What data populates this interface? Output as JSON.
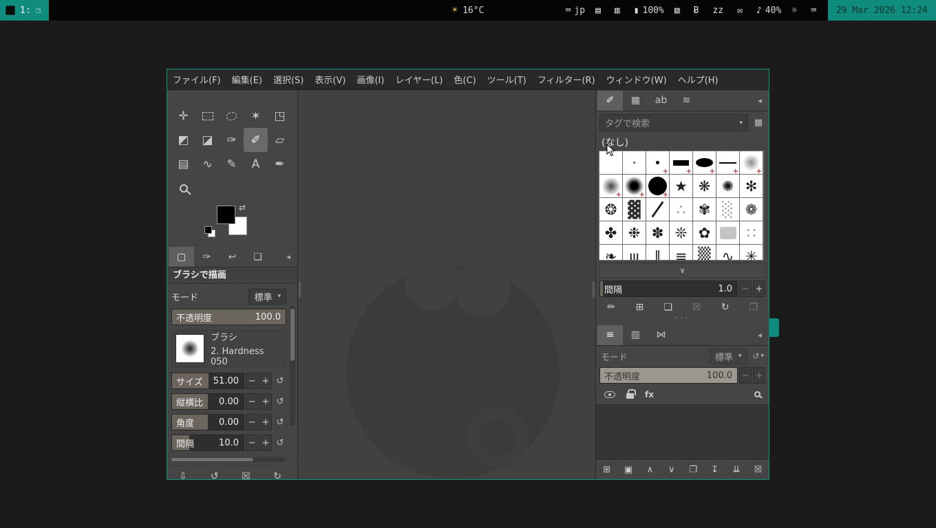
{
  "statusbar": {
    "workspace": {
      "label": "1:",
      "window_icon": "❐"
    },
    "weather": {
      "icon": "☀",
      "temp": "16°C"
    },
    "modules": [
      {
        "name": "keyboard-layout-indicator",
        "icon": "⌨",
        "label": "jp"
      },
      {
        "name": "clipboard-indicator",
        "icon": "▤",
        "label": ""
      },
      {
        "name": "notes-indicator",
        "icon": "▥",
        "label": ""
      },
      {
        "name": "battery-indicator",
        "icon": "▮",
        "label": "100%"
      },
      {
        "name": "display-indicator",
        "icon": "▧",
        "label": ""
      },
      {
        "name": "bluetooth-indicator",
        "icon": "Ƀ",
        "label": ""
      },
      {
        "name": "idle-inhibitor",
        "icon": "zz",
        "label": ""
      },
      {
        "name": "notifications-indicator",
        "icon": "✉",
        "label": ""
      },
      {
        "name": "volume-indicator",
        "icon": "♪",
        "label": "40%"
      },
      {
        "name": "brightness-indicator",
        "icon": "☼",
        "label": ""
      },
      {
        "name": "input-method-indicator",
        "icon": "⌨",
        "label": ""
      }
    ],
    "clock": "29 Mar 2026 12:24"
  },
  "gimp": {
    "menubar": [
      "ファイル(F)",
      "編集(E)",
      "選択(S)",
      "表示(V)",
      "画像(I)",
      "レイヤー(L)",
      "色(C)",
      "ツール(T)",
      "フィルター(R)",
      "ウィンドウ(W)",
      "ヘルプ(H)"
    ],
    "toolbox": {
      "swap_icon": "⇄",
      "tools": [
        {
          "name": "move-tool",
          "g": "✛",
          "cls": ""
        },
        {
          "name": "rectangle-select-tool",
          "g": "",
          "cls": "t-rect"
        },
        {
          "name": "free-select-tool",
          "g": "",
          "cls": "t-free"
        },
        {
          "name": "fuzzy-select-tool",
          "g": "✶",
          "cls": ""
        },
        {
          "name": "crop-tool",
          "g": "◳",
          "cls": ""
        },
        {
          "name": "transform-tool",
          "g": "◩",
          "cls": ""
        },
        {
          "name": "bucket-fill-tool",
          "g": "◪",
          "cls": ""
        },
        {
          "name": "ink-tool",
          "g": "✑",
          "cls": ""
        },
        {
          "name": "paintbrush-tool",
          "g": "✐",
          "cls": "active"
        },
        {
          "name": "eraser-tool",
          "g": "▱",
          "cls": ""
        },
        {
          "name": "clone-tool",
          "g": "▤",
          "cls": ""
        },
        {
          "name": "smudge-tool",
          "g": "∿",
          "cls": ""
        },
        {
          "name": "paths-tool",
          "g": "✎",
          "cls": ""
        },
        {
          "name": "text-tool",
          "g": "A",
          "cls": ""
        },
        {
          "name": "color-picker-tool",
          "g": "✒",
          "cls": ""
        },
        {
          "name": "zoom-tool",
          "g": "",
          "cls": "t-zoom"
        }
      ]
    },
    "left_dock": {
      "menu_icon": "◂",
      "tabs": [
        {
          "name": "tab-tool-options",
          "g": "▢",
          "cls": "active"
        },
        {
          "name": "tab-device-status",
          "g": "✑",
          "cls": ""
        },
        {
          "name": "tab-undo-history",
          "g": "↩",
          "cls": ""
        },
        {
          "name": "tab-images",
          "g": "❏",
          "cls": ""
        }
      ]
    },
    "tool_options": {
      "title": "ブラシで描画",
      "mode": {
        "label": "モード",
        "value": "標準",
        "chev": "▾"
      },
      "opacity": {
        "label": "不透明度",
        "value": "100.0",
        "fill": 100
      },
      "brush": {
        "label": "ブラシ",
        "value": "2. Hardness 050"
      },
      "sliders": [
        {
          "name": "size-slider",
          "label": "サイズ",
          "value": "51.00",
          "fill": 51,
          "minus": "−",
          "plus": "+",
          "reset": "↺"
        },
        {
          "name": "aspect-ratio-slider",
          "label": "縦横比",
          "value": "0.00",
          "fill": 50,
          "minus": "−",
          "plus": "+",
          "reset": "↺"
        },
        {
          "name": "angle-slider",
          "label": "角度",
          "value": "0.00",
          "fill": 50,
          "minus": "−",
          "plus": "+",
          "reset": "↺"
        },
        {
          "name": "spacing-slider",
          "label": "間隔",
          "value": "10.0",
          "fill": 24,
          "minus": "−",
          "plus": "+",
          "reset": "↺"
        }
      ],
      "footer": [
        {
          "name": "save-tool-preset-button",
          "g": "⇩"
        },
        {
          "name": "restore-tool-preset-button",
          "g": "↺"
        },
        {
          "name": "delete-tool-preset-button",
          "g": "☒"
        },
        {
          "name": "reset-tool-options-button",
          "g": "↻"
        }
      ]
    },
    "brushes_dock": {
      "menu_icon": "◂",
      "tabs": [
        {
          "name": "tab-brushes",
          "g": "✐",
          "cls": "active"
        },
        {
          "name": "tab-patterns",
          "g": "▦",
          "cls": ""
        },
        {
          "name": "tab-fonts",
          "g": "ab",
          "cls": ""
        },
        {
          "name": "tab-document-history",
          "g": "≋",
          "cls": ""
        }
      ],
      "search": {
        "placeholder": "タグで検索",
        "chev": "▾"
      },
      "view_button_icon": "▦",
      "selected_tag": "(なし)",
      "expand_icon": "∨",
      "sizer": "···",
      "spacing": {
        "name": "brush-spacing-slider",
        "label": "間隔",
        "value": "1.0",
        "fill": 2,
        "minus": "−",
        "plus": "+"
      },
      "grid": [
        {
          "cls": "bc-blank",
          "g": ""
        },
        {
          "cls": "bc-speck",
          "g": ""
        },
        {
          "cls": "bc-dot plus",
          "g": ""
        },
        {
          "cls": "bc-bar plus",
          "g": ""
        },
        {
          "cls": "bc-ell plus",
          "g": ""
        },
        {
          "cls": "bc-line plus",
          "g": ""
        },
        {
          "cls": "bc-soft1 plus",
          "g": ""
        },
        {
          "cls": "bc-soft2 plus",
          "g": ""
        },
        {
          "cls": "bc-soft3 plus",
          "g": ""
        },
        {
          "cls": "bc-disc plus",
          "g": ""
        },
        {
          "cls": "",
          "g": "★"
        },
        {
          "cls": "",
          "g": "❋"
        },
        {
          "cls": "",
          "g": "✺"
        },
        {
          "cls": "",
          "g": "✻"
        },
        {
          "cls": "",
          "g": "❂"
        },
        {
          "cls": "bc-dark",
          "g": "▓"
        },
        {
          "cls": "bc-stroke",
          "g": ""
        },
        {
          "cls": "bc-lite",
          "g": "∴"
        },
        {
          "cls": "",
          "g": "✾"
        },
        {
          "cls": "bc-lite",
          "g": "░"
        },
        {
          "cls": "",
          "g": "❁"
        },
        {
          "cls": "",
          "g": "✤"
        },
        {
          "cls": "",
          "g": "❉"
        },
        {
          "cls": "",
          "g": "✽"
        },
        {
          "cls": "",
          "g": "❊"
        },
        {
          "cls": "",
          "g": "✿"
        },
        {
          "cls": "bc-softsq",
          "g": ""
        },
        {
          "cls": "bc-lite",
          "g": "∷"
        },
        {
          "cls": "",
          "g": "❧"
        },
        {
          "cls": "",
          "g": "ψ"
        },
        {
          "cls": "",
          "g": "∥"
        },
        {
          "cls": "",
          "g": "≡"
        },
        {
          "cls": "bc-dark",
          "g": "▒"
        },
        {
          "cls": "",
          "g": "∿"
        },
        {
          "cls": "",
          "g": "✳"
        }
      ],
      "actions": [
        {
          "name": "edit-brush-button",
          "g": "✏",
          "cls": ""
        },
        {
          "name": "new-brush-button",
          "g": "⊞",
          "cls": ""
        },
        {
          "name": "duplicate-brush-button",
          "g": "❏",
          "cls": ""
        },
        {
          "name": "delete-brush-button",
          "g": "☒",
          "cls": "disabled"
        },
        {
          "name": "refresh-brushes-button",
          "g": "↻",
          "cls": ""
        },
        {
          "name": "open-brush-as-image-button",
          "g": "❐",
          "cls": "disabled"
        }
      ]
    },
    "layers_dock": {
      "menu_icon": "◂",
      "tabs": [
        {
          "name": "tab-layers",
          "g": "≡",
          "cls": "active"
        },
        {
          "name": "tab-channels",
          "g": "▥",
          "cls": ""
        },
        {
          "name": "tab-paths",
          "g": "⋈",
          "cls": ""
        }
      ],
      "mode": {
        "label": "モード",
        "value": "標準",
        "chev": "▾",
        "reset": "↺"
      },
      "opacity": {
        "label": "不透明度",
        "value": "100.0",
        "fill": 100,
        "minus": "−",
        "plus": "+"
      },
      "header": {
        "fx": "fx"
      },
      "footer": [
        {
          "name": "new-layer-button",
          "g": "⊞"
        },
        {
          "name": "new-layer-group-button",
          "g": "▣"
        },
        {
          "name": "raise-layer-button",
          "g": "∧"
        },
        {
          "name": "lower-layer-button",
          "g": "∨"
        },
        {
          "name": "duplicate-layer-button",
          "g": "❐"
        },
        {
          "name": "anchor-layer-button",
          "g": "↧"
        },
        {
          "name": "merge-down-button",
          "g": "⇊"
        },
        {
          "name": "delete-layer-button",
          "g": "☒"
        }
      ]
    }
  }
}
